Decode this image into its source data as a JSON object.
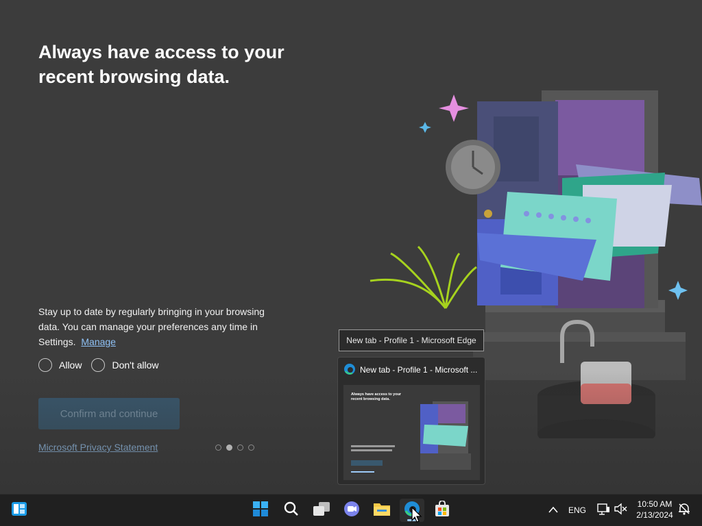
{
  "app": {
    "headline": "Always have access to your recent browsing data.",
    "body": "Stay up to date by regularly bringing in your browsing data. You can manage your preferences any time in Settings.",
    "manage_link": "Manage",
    "options": {
      "allow": "Allow",
      "dont_allow": "Don't allow"
    },
    "confirm_button": "Confirm and continue",
    "privacy_link": "Microsoft Privacy Statement",
    "page_indicator": {
      "total": 4,
      "current": 2
    }
  },
  "preview": {
    "tooltip": "New tab - Profile 1 - Microsoft Edge",
    "title": "New tab - Profile 1 - Microsoft ..."
  },
  "taskbar": {
    "language": "ENG",
    "time": "10:50 AM",
    "date": "2/13/2024",
    "icons": [
      "widgets-icon",
      "start-icon",
      "search-icon",
      "task-view-icon",
      "teams-icon",
      "file-explorer-icon",
      "edge-icon",
      "store-icon"
    ]
  },
  "colors": {
    "background": "#3c3c3c",
    "accent_link": "#9ccaf7",
    "button_disabled": "#39586e",
    "taskbar": "#202020"
  }
}
